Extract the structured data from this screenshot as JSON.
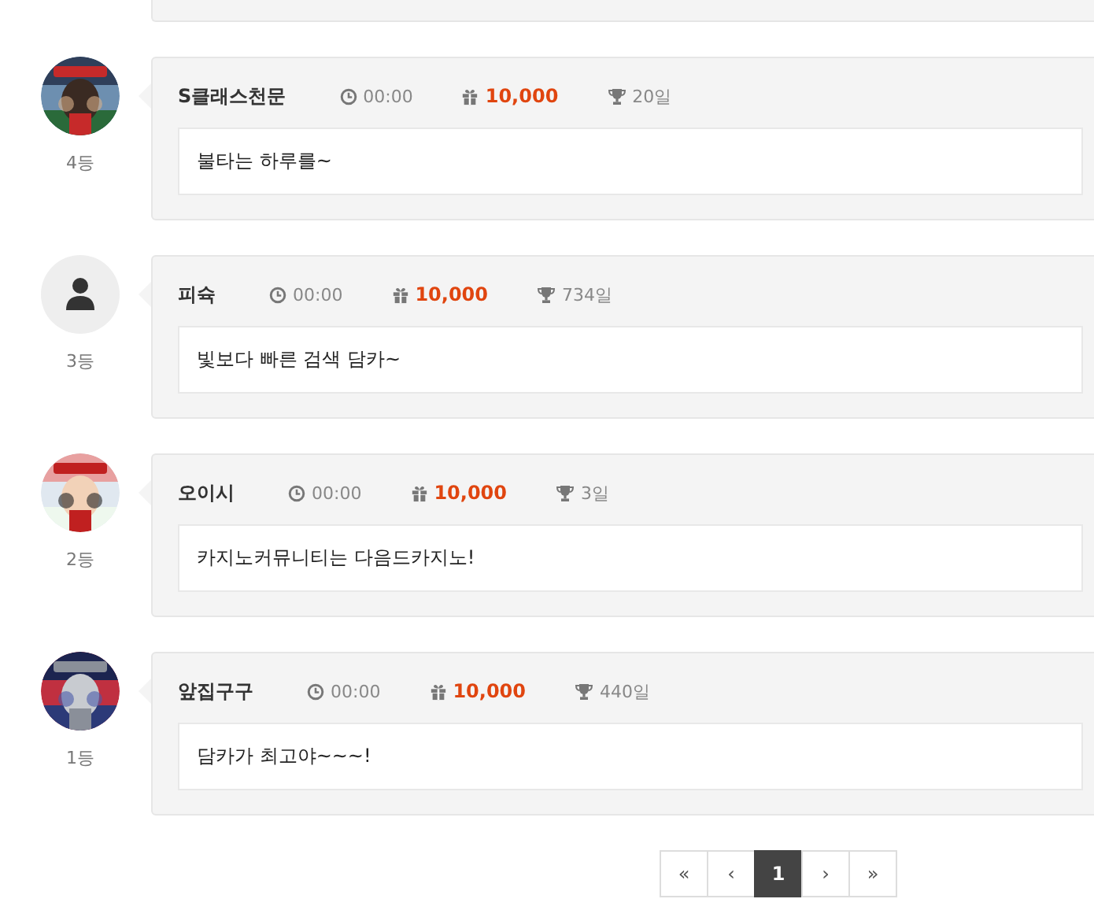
{
  "comments": [
    {
      "rank": "4등",
      "name": "S클래스천문",
      "time": "00:00",
      "points": "10,000",
      "days": "20일",
      "message": "불타는 하루를~"
    },
    {
      "avatar": {
        "kind": "default"
      },
      "rank": "3등",
      "name": "피슉",
      "time": "00:00",
      "points": "10,000",
      "days": "734일",
      "message": "빛보다 빠른 검색 담카~"
    },
    {
      "rank": "2등",
      "name": "오이시",
      "time": "00:00",
      "points": "10,000",
      "days": "3일",
      "message": "카지노커뮤니티는 다음드카지노!"
    },
    {
      "rank": "1등",
      "name": "앞집구구",
      "time": "00:00",
      "points": "10,000",
      "days": "440일",
      "message": "담카가 최고야~~~!"
    }
  ],
  "pagination": [
    {
      "label": "«",
      "selected": false
    },
    {
      "label": "‹",
      "selected": false
    },
    {
      "label": "1",
      "selected": true
    },
    {
      "label": "›",
      "selected": false
    },
    {
      "label": "»",
      "selected": false
    }
  ]
}
